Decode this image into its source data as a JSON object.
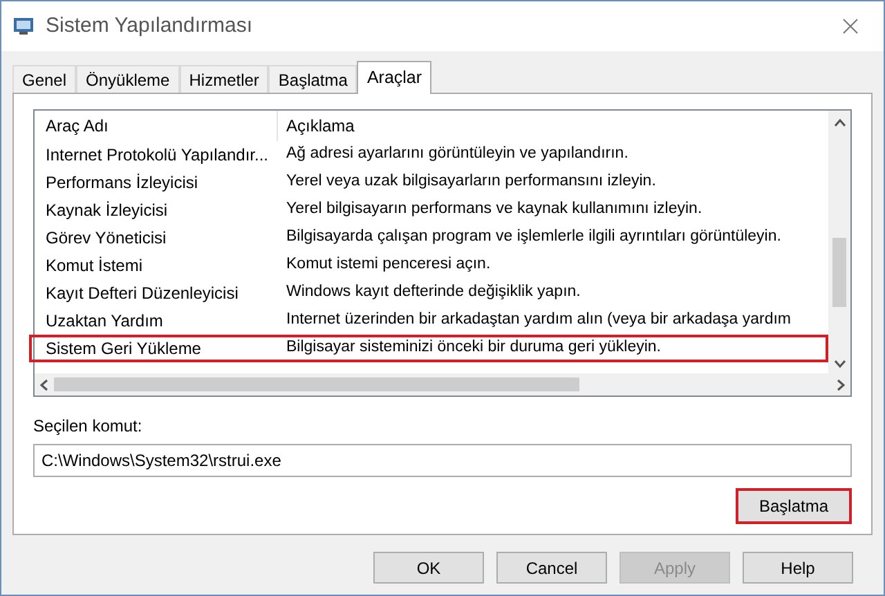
{
  "window": {
    "title": "Sistem Yapılandırması"
  },
  "tabs": [
    {
      "label": "Genel",
      "selected": false
    },
    {
      "label": "Önyükleme",
      "selected": false
    },
    {
      "label": "Hizmetler",
      "selected": false
    },
    {
      "label": "Başlatma",
      "selected": false
    },
    {
      "label": "Araçlar",
      "selected": true
    }
  ],
  "table": {
    "columns": [
      "Araç Adı",
      "Açıklama"
    ],
    "rows": [
      {
        "cells": [
          "Internet Protokolü Yapılandır...",
          "Ağ adresi ayarlarını görüntüleyin ve yapılandırın."
        ],
        "highlighted": false
      },
      {
        "cells": [
          "Performans İzleyicisi",
          "Yerel veya uzak bilgisayarların performansını izleyin."
        ],
        "highlighted": false
      },
      {
        "cells": [
          "Kaynak İzleyicisi",
          "Yerel bilgisayarın performans ve kaynak kullanımını izleyin."
        ],
        "highlighted": false
      },
      {
        "cells": [
          "Görev Yöneticisi",
          "Bilgisayarda çalışan program ve işlemlerle ilgili ayrıntıları görüntüleyin."
        ],
        "highlighted": false
      },
      {
        "cells": [
          "Komut İstemi",
          "Komut istemi penceresi açın."
        ],
        "highlighted": false
      },
      {
        "cells": [
          "Kayıt Defteri Düzenleyicisi",
          "Windows kayıt defterinde değişiklik yapın."
        ],
        "highlighted": false
      },
      {
        "cells": [
          "Uzaktan Yardım",
          "Internet üzerinden bir arkadaştan yardım alın (veya bir arkadaşa yardım"
        ],
        "highlighted": false
      },
      {
        "cells": [
          "Sistem Geri Yükleme",
          "Bilgisayar sisteminizi önceki bir duruma geri yükleyin."
        ],
        "highlighted": true
      }
    ]
  },
  "selected_command": {
    "label": "Seçilen komut:",
    "value": "C:\\Windows\\System32\\rstrui.exe"
  },
  "launch_button": {
    "label": "Başlatma",
    "highlighted": true
  },
  "buttons": [
    {
      "label": "OK",
      "disabled": false
    },
    {
      "label": "Cancel",
      "disabled": false
    },
    {
      "label": "Apply",
      "disabled": true
    },
    {
      "label": "Help",
      "disabled": false
    }
  ]
}
